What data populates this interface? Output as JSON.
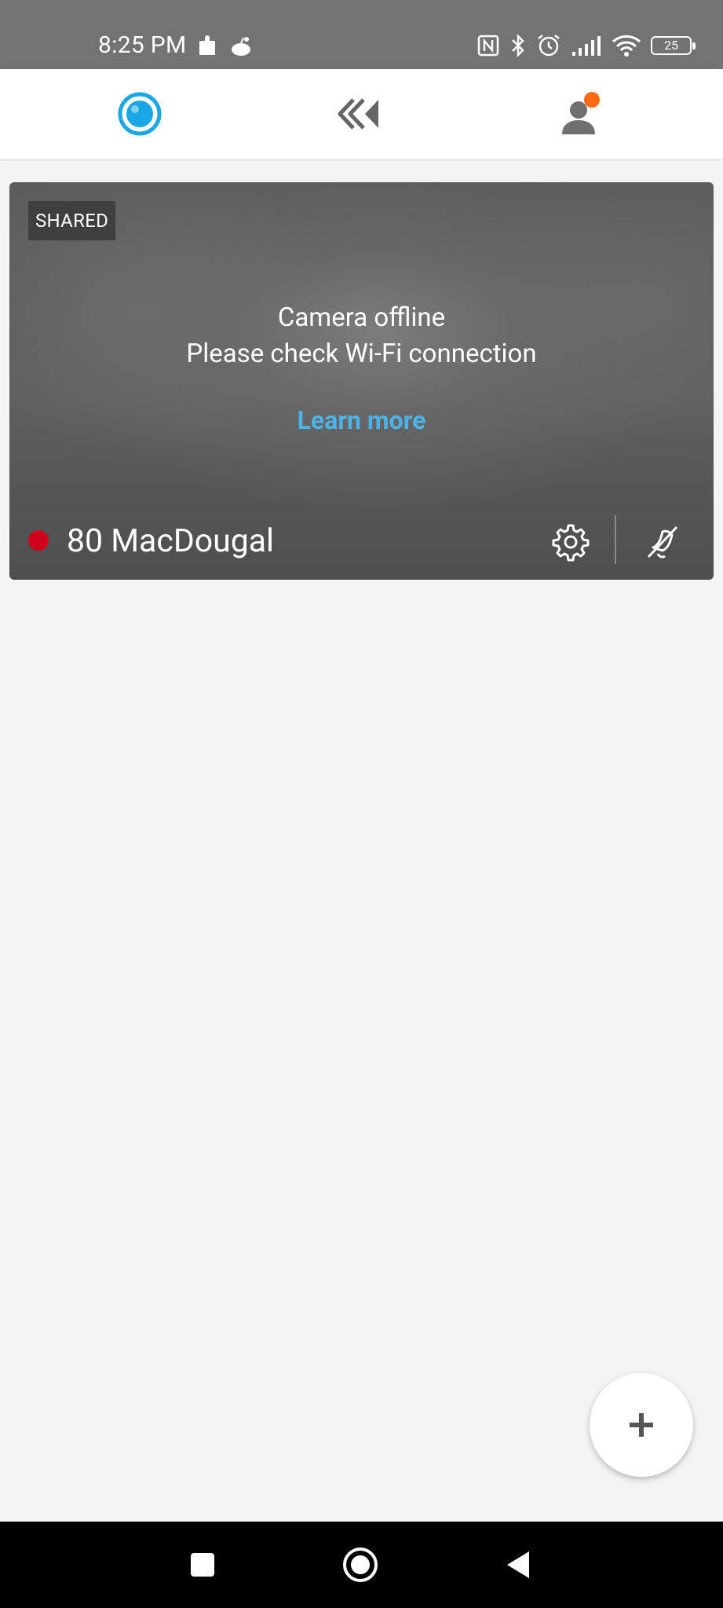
{
  "status_bar": {
    "time": "8:25 PM",
    "battery": "25",
    "background": "#737373"
  },
  "top_nav": {
    "items": [
      {
        "name": "live",
        "icon": "camera-lens-icon",
        "active": true
      },
      {
        "name": "history",
        "icon": "rewind-icon",
        "active": false
      },
      {
        "name": "profile",
        "icon": "profile-icon",
        "has_notification": true
      }
    ],
    "active_color": "#1aa7e6",
    "notification_color": "#ff6a13"
  },
  "camera_card": {
    "badge": "SHARED",
    "message_title": "Camera offline",
    "message_subtitle": "Please check Wi-Fi connection",
    "link_label": "Learn more",
    "camera_name": "80 MacDougal",
    "status_color": "#d0021b",
    "link_color": "#4cb3e8"
  },
  "fab": {
    "label": "+"
  }
}
